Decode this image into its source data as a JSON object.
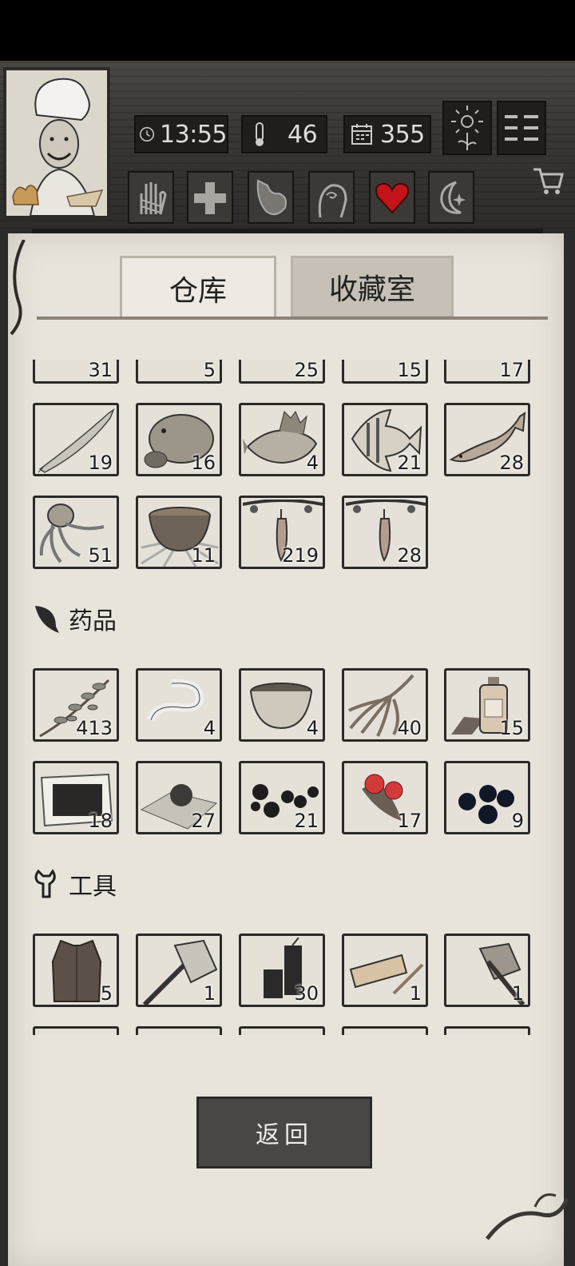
{
  "header": {
    "time": "13:55",
    "temperature": "46",
    "days": "355",
    "icons": [
      "clock-icon",
      "thermometer-icon",
      "calendar-icon",
      "sunflower-icon",
      "menu-icon",
      "cart-icon"
    ]
  },
  "status_icons": [
    "hand-icon",
    "medical-cross-icon",
    "stomach-icon",
    "head-icon",
    "heart-icon",
    "moon-icon"
  ],
  "tabs": [
    {
      "label": "仓库",
      "active": true
    },
    {
      "label": "收藏室",
      "active": false
    }
  ],
  "rows": {
    "partial_top": [
      "31",
      "5",
      "25",
      "15",
      "17"
    ],
    "fish": [
      {
        "icon": "saury-fish-icon",
        "count": "19"
      },
      {
        "icon": "grouper-fish-icon",
        "count": "16"
      },
      {
        "icon": "perch-fish-icon",
        "count": "4"
      },
      {
        "icon": "angelfish-icon",
        "count": "21"
      },
      {
        "icon": "cod-fish-icon",
        "count": "28"
      }
    ],
    "misc": [
      {
        "icon": "octopus-icon",
        "count": "51"
      },
      {
        "icon": "soup-bowl-icon",
        "count": "11"
      },
      {
        "icon": "hanging-meat-icon",
        "count": "219"
      },
      {
        "icon": "hanging-meat-icon",
        "count": "28"
      }
    ]
  },
  "medicine": {
    "title": "药品",
    "items": [
      {
        "icon": "herb-branch-icon",
        "count": "413"
      },
      {
        "icon": "bandage-icon",
        "count": "4"
      },
      {
        "icon": "herbal-tea-bowl-icon",
        "count": "4"
      },
      {
        "icon": "ginseng-root-icon",
        "count": "40"
      },
      {
        "icon": "medicine-bottle-icon",
        "count": "15"
      },
      {
        "icon": "plaster-icon",
        "count": "18"
      },
      {
        "icon": "pill-on-paper-icon",
        "count": "27"
      },
      {
        "icon": "black-pills-icon",
        "count": "21"
      },
      {
        "icon": "red-berries-icon",
        "count": "17"
      },
      {
        "icon": "dark-berries-icon",
        "count": "9"
      }
    ]
  },
  "tools": {
    "title": "工具",
    "items": [
      {
        "icon": "vest-icon",
        "count": "5"
      },
      {
        "icon": "axe-icon",
        "count": "1"
      },
      {
        "icon": "firecracker-icon",
        "count": "30"
      },
      {
        "icon": "flashlight-icon",
        "count": "1"
      },
      {
        "icon": "rusty-axe-icon",
        "count": "1"
      }
    ]
  },
  "back_button": "返回"
}
